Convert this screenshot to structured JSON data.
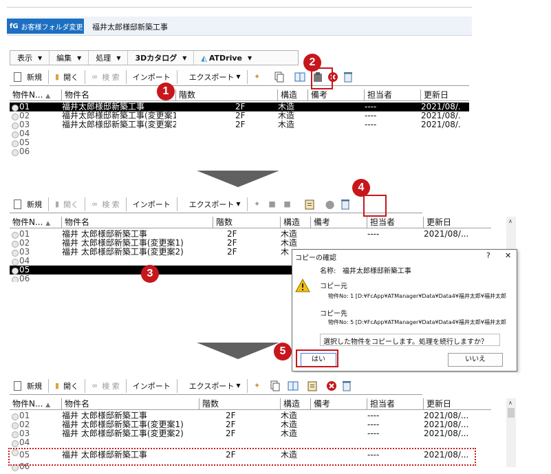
{
  "titlebar": {
    "folder_button": "お客様フォルダ変更",
    "project_name": "福井太郎様邸新築工事"
  },
  "menus": [
    {
      "label": "表示",
      "caret": "▼"
    },
    {
      "label": "編集",
      "caret": "▼"
    },
    {
      "label": "処理",
      "caret": "▼"
    },
    {
      "label": "3Dカタログ",
      "caret": "▼"
    },
    {
      "label": "ATDrive",
      "caret": "▼"
    }
  ],
  "toolbar": {
    "new": "新規",
    "open": "開く",
    "search": "検 索",
    "import": "インポート",
    "export": "エクスポート",
    "export_caret": "▼"
  },
  "columns": [
    "物件N...",
    "物件名",
    "階数",
    "構造",
    "備考",
    "担当者",
    "更新日"
  ],
  "sort_indicator": "▲",
  "list1": [
    {
      "no": "01",
      "name": "福井太郎様邸新築工事",
      "floors": "2F",
      "struct": "木造",
      "staff": "----",
      "date": "2021/08/."
    },
    {
      "no": "02",
      "name": "福井太郎様邸新築工事(変更案1)",
      "floors": "2F",
      "struct": "木造",
      "staff": "----",
      "date": "2021/08/."
    },
    {
      "no": "03",
      "name": "福井太郎様邸新築工事(変更案2)",
      "floors": "2F",
      "struct": "木造",
      "staff": "----",
      "date": "2021/08/."
    },
    {
      "no": "04"
    },
    {
      "no": "05"
    },
    {
      "no": "06"
    }
  ],
  "list2": [
    {
      "no": "01",
      "name": "福井 太郎様邸新築工事",
      "floors": "2F",
      "struct": "木造",
      "staff": "----",
      "date": "2021/08/..."
    },
    {
      "no": "02",
      "name": "福井 太郎様邸新築工事(変更案1)",
      "floors": "2F",
      "struct": "木造",
      "staff": "",
      "date": ""
    },
    {
      "no": "03",
      "name": "福井 太郎様邸新築工事(変更案2)",
      "floors": "2F",
      "struct": "木",
      "staff": "",
      "date": ""
    },
    {
      "no": "04"
    },
    {
      "no": "05"
    },
    {
      "no": "06"
    }
  ],
  "list3": [
    {
      "no": "01",
      "name": "福井 太郎様邸新築工事",
      "floors": "2F",
      "struct": "木造",
      "staff": "----",
      "date": "2021/08/..."
    },
    {
      "no": "02",
      "name": "福井 太郎様邸新築工事(変更案1)",
      "floors": "2F",
      "struct": "木造",
      "staff": "----",
      "date": "2021/08/..."
    },
    {
      "no": "03",
      "name": "福井 太郎様邸新築工事(変更案2)",
      "floors": "2F",
      "struct": "木造",
      "staff": "----",
      "date": "2021/08/..."
    },
    {
      "no": "04"
    },
    {
      "no": "05",
      "name": "福井 太郎様邸新築工事",
      "floors": "2F",
      "struct": "木造",
      "staff": "----",
      "date": "2021/08/..."
    },
    {
      "no": "06"
    }
  ],
  "dialog": {
    "title": "コピーの確認",
    "help": "?",
    "close": "✕",
    "name_label": "名称:",
    "name_value": "福井太郎様邸新築工事",
    "src_heading": "コピー元",
    "src_line": "物件No: 1  [D:¥FcApp¥ATManager¥Data¥Data4¥福井太郎¥福井太郎",
    "dst_heading": "コピー先",
    "dst_line": "物件No: 5  [D:¥FcApp¥ATManager¥Data¥Data4¥福井太郎¥福井太郎",
    "question": "選択した物件をコピーします。処理を続行しますか？",
    "yes": "はい",
    "no": "いいえ"
  },
  "badges": [
    "1",
    "2",
    "3",
    "4",
    "5"
  ],
  "colors": {
    "badge": "#c8161d",
    "accent_blue": "#1d6fc2",
    "highlight_dotted": "#c8161d"
  }
}
